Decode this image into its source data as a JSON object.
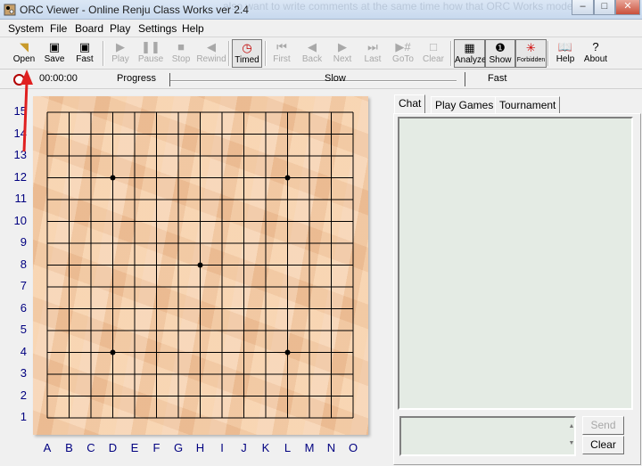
{
  "window": {
    "title": "ORC Viewer - Online Renju Class Works ver 2.4",
    "background_text": "also want to write comments at the same time how that ORC Works mode",
    "min_symbol": "–",
    "max_symbol": "□",
    "close_symbol": "✕"
  },
  "menu": [
    "System",
    "File",
    "Board",
    "Play",
    "Settings",
    "Help"
  ],
  "toolbar": {
    "open": "Open",
    "save": "Save",
    "fast": "Fast",
    "play": "Play",
    "pause": "Pause",
    "stop": "Stop",
    "rewind": "Rewind",
    "timed": "Timed",
    "first": "First",
    "back": "Back",
    "next": "Next",
    "last": "Last",
    "goto": "GoTo",
    "clear": "Clear",
    "analyze": "Analyze",
    "show": "Show",
    "forbidden": "Forbidden",
    "help": "Help",
    "about": "About"
  },
  "progress": {
    "timer": "00:00:00",
    "progress_label": "Progress",
    "slow_label": "Slow",
    "fast_label": "Fast",
    "progress_value": 0,
    "speed_value": 0.9
  },
  "board": {
    "rows": [
      "15",
      "14",
      "13",
      "12",
      "11",
      "10",
      "9",
      "8",
      "7",
      "6",
      "5",
      "4",
      "3",
      "2",
      "1"
    ],
    "columns": [
      "A",
      "B",
      "C",
      "D",
      "E",
      "F",
      "G",
      "H",
      "I",
      "J",
      "K",
      "L",
      "M",
      "N",
      "O"
    ],
    "star_points": [
      "D12",
      "L12",
      "H8",
      "D4",
      "L4"
    ]
  },
  "panel": {
    "tabs": [
      "Chat",
      "Play Games",
      "Tournament"
    ],
    "active_tab": "Chat",
    "send_label": "Send",
    "clear_label": "Clear",
    "scroll_up": "▲",
    "scroll_down": "▼"
  },
  "colors": {
    "label_color": "#000080",
    "chat_bg": "#e4ebe4",
    "board_wood": "#f2c9a4",
    "annotation_arrow": "#e02020"
  }
}
